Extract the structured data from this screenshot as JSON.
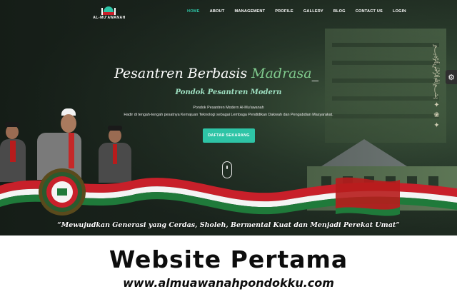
{
  "logo": {
    "text": "AL-MU'AWANAH"
  },
  "nav": {
    "items": [
      {
        "label": "HOME",
        "active": true
      },
      {
        "label": "ABOUT",
        "active": false
      },
      {
        "label": "MANAGEMENT",
        "active": false
      },
      {
        "label": "PROFILE",
        "active": false
      },
      {
        "label": "GALLERY",
        "active": false
      },
      {
        "label": "BLOG",
        "active": false
      },
      {
        "label": "CONTACT US",
        "active": false
      },
      {
        "label": "LOGIN",
        "active": false
      }
    ]
  },
  "hero": {
    "title_main": "Pesantren Berbasis ",
    "title_accent": "Madrasa",
    "title_cursor": "_",
    "subtitle": "Pondok Pesantren Modern",
    "line1": "Pondok Pesantren Modern Al-Mu'awanah",
    "line2": "Hadir di tengah-tengah pesatnya Kemajuan Teknologi sebagai Lembaga Pendidikan Dakwah dan Pengabdian Masyarakat.",
    "cta_label": "DAFTAR SEKARANG",
    "motto": "“Mewujudkan Generasi yang Cerdas, Sholeh, Bermental Kuat dan Menjadi Perekat Umat”"
  },
  "side": {
    "gear_icon": "gear-icon"
  },
  "banner": {
    "title": "Website Pertama",
    "url": "www.almuawanahpondokku.com"
  },
  "colors": {
    "accent": "#2ec4a6",
    "title_accent": "#7fc98c",
    "ribbon_red": "#c8202a",
    "ribbon_green": "#1f7a3a"
  }
}
